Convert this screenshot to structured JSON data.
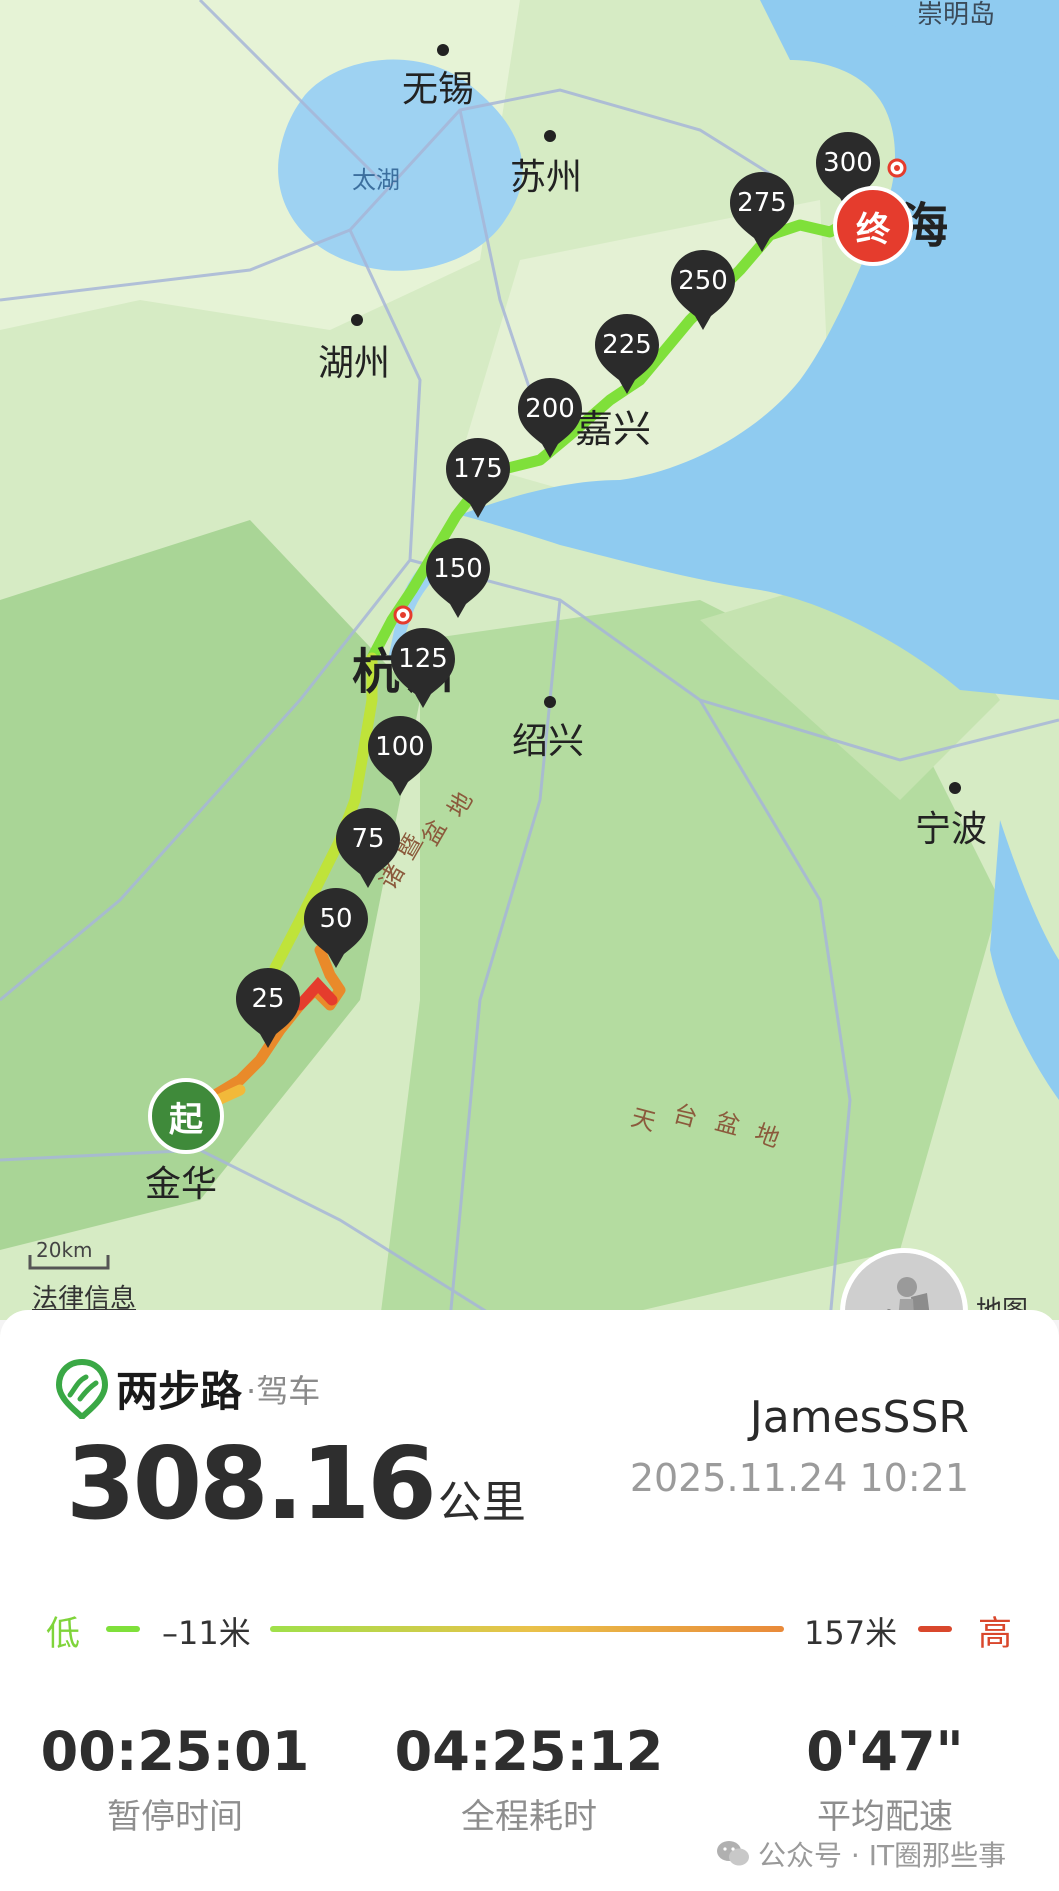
{
  "map": {
    "places": {
      "chongming": "崇明岛",
      "wuxi": "无锡",
      "suzhou": "苏州",
      "taihu": "太湖",
      "huzhou": "湖州",
      "jiaxing": "嘉兴",
      "hangzhou": "杭州",
      "shaoxing": "绍兴",
      "ningbo": "宁波",
      "jinhua": "金华",
      "shanghai": "海",
      "basin_1": "盆",
      "basin_2": "地",
      "basin_3": "诸",
      "basin_4": "暨",
      "tiantai_1": "天",
      "tiantai_2": "台",
      "tiantai_3": "盆",
      "tiantai_4": "地",
      "map_brand": "地图"
    },
    "start_label": "起",
    "end_label": "终",
    "scale": "20km",
    "legal": "法律信息",
    "km_markers": [
      "25",
      "50",
      "75",
      "100",
      "125",
      "150",
      "175",
      "200",
      "225",
      "250",
      "275",
      "300"
    ]
  },
  "app": {
    "name": "两步路",
    "mode": "·驾车",
    "user": "JamesSSR",
    "datetime": "2025.11.24 10:21",
    "distance": "308.16",
    "distance_unit": "公里"
  },
  "elevation": {
    "low_label": "低",
    "min": "–11米",
    "max": "157米",
    "high_label": "高"
  },
  "stats": [
    {
      "value": "00:25:01",
      "label": "暂停时间"
    },
    {
      "value": "04:25:12",
      "label": "全程耗时"
    },
    {
      "value": "0'47\"",
      "label": "平均配速"
    }
  ],
  "watermark": "公众号 · IT圈那些事",
  "colors": {
    "route_green": "#7fe03a",
    "route_red": "#e53c2d",
    "start_green": "#3f8a3a",
    "pin": "#2b2b2b"
  }
}
